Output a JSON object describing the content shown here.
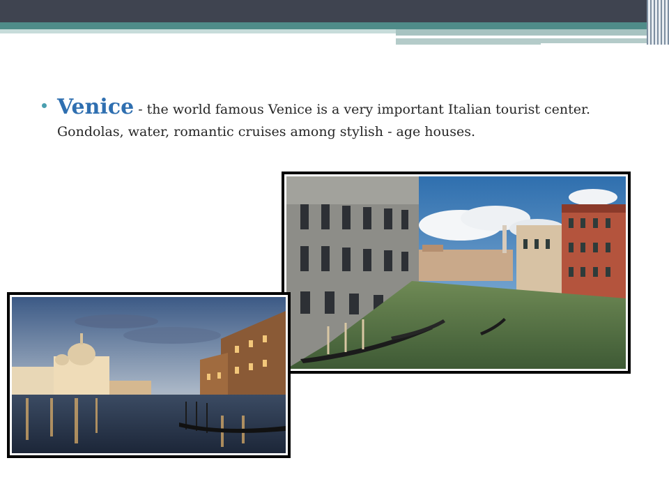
{
  "slide": {
    "bullet": {
      "title": "Venice",
      "text": " - the world famous Venice is a very important Italian tourist center. Gondolas, water, romantic cruises among stylish - age houses."
    },
    "photos": [
      {
        "subject": "Grand Canal with gondolas and palazzi"
      },
      {
        "subject": "Santa Maria della Salute at dusk"
      }
    ]
  },
  "colors": {
    "header_dark": "#3f4450",
    "header_teal": "#4f8c89",
    "title_blue": "#2f6fb0",
    "bullet": "#4a9fb0"
  }
}
